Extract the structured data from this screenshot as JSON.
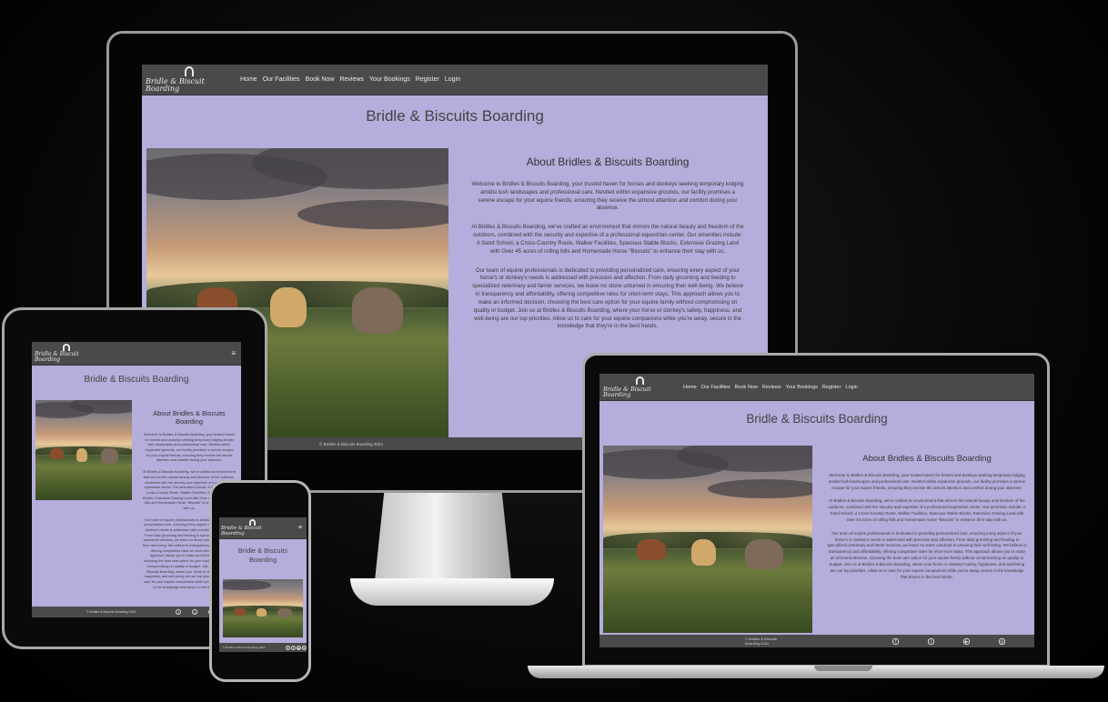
{
  "site": {
    "brand": "Bridle & Biscuit Boarding",
    "nav_links": [
      "Home",
      "Our Facilities",
      "Book Now",
      "Reviews",
      "Your Bookings",
      "Register",
      "Login"
    ],
    "menu_glyph": "≡",
    "title": "Bridle & Biscuits Boarding",
    "about_heading": "About Bridles & Biscuits Boarding",
    "paragraphs": [
      "Welcome to Bridles & Biscuits Boarding, your trusted haven for horses and donkeys seeking temporary lodging amidst lush landscapes and professional care. Nestled within expansive grounds, our facility promises a serene escape for your equine friends, ensuring they receive the utmost attention and comfort during your absence.",
      "At Bridles & Biscuits Boarding, we've crafted an environment that mirrors the natural beauty and freedom of the outdoors, combined with the security and expertise of a professional equestrian center. Our amenities include: A Sand School, a Cross-Country Route, Walker Facilities, Spacious Stable Blocks, Extensive Grazing Land with Over 45 acres of rolling hills and Homemade Horse \"Biscuits\" to enhance their stay with us.",
      "Our team of equine professionals is dedicated to providing personalized care, ensuring every aspect of your horse's or donkey's needs is addressed with precision and affection. From daily grooming and feeding to specialized veterinary and farrier services, we leave no stone unturned in ensuring their well-being. We believe in transparency and affordability, offering competitive rates for short-term stays. This approach allows you to make an informed decision, choosing the best care option for your equine family without compromising on quality or budget. Join us at Bridles & Biscuits Boarding, where your horse or donkey's safety, happiness, and well-being are our top priorities. Allow us to care for your equine companions while you're away, secure in the knowledge that they're in the best hands."
    ],
    "footer_text": "© Bridles & Biscuits Boarding 2024",
    "social_icons": [
      "facebook-icon",
      "twitter-icon",
      "youtube-icon",
      "instagram-icon"
    ],
    "social_glyphs": [
      "f",
      "t",
      "▶",
      "◎"
    ],
    "colors": {
      "background": "#b5addb",
      "navbar": "#4a4a4a",
      "text": "#333333"
    }
  }
}
